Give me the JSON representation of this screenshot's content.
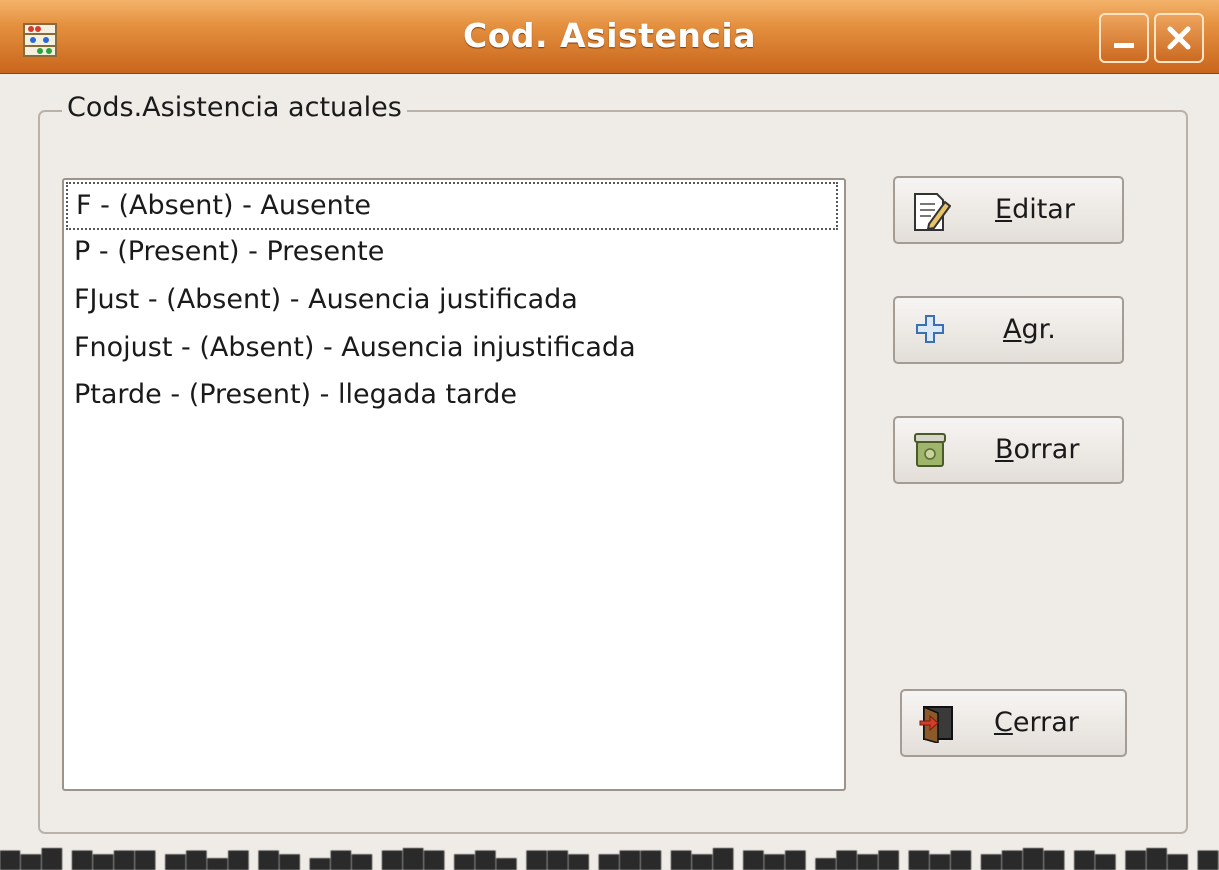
{
  "window": {
    "title": "Cod. Asistencia",
    "app_icon": "abacus-icon",
    "controls": {
      "minimize_icon": "minimize-icon",
      "close_icon": "close-icon"
    }
  },
  "frame": {
    "legend": "Cods.Asistencia actuales"
  },
  "codes_list": {
    "items": [
      "F - (Absent) - Ausente",
      "P - (Present) - Presente",
      "FJust - (Absent) - Ausencia justificada",
      "Fnojust - (Absent) - Ausencia injustificada",
      "Ptarde - (Present) - llegada tarde"
    ],
    "focused_index": 0
  },
  "buttons": {
    "editar": {
      "mnemonic": "E",
      "rest": "ditar",
      "icon": "edit-document-icon"
    },
    "agregar": {
      "mnemonic": "A",
      "rest": "gr.",
      "icon": "plus-icon"
    },
    "borrar": {
      "mnemonic": "B",
      "rest": "orrar",
      "icon": "trash-icon"
    },
    "cerrar": {
      "mnemonic": "C",
      "rest": "errar",
      "icon": "exit-door-icon"
    }
  },
  "colors": {
    "titlebar": "#d97a2c",
    "dialog_bg": "#efebe7",
    "list_bg": "#ffffff"
  }
}
